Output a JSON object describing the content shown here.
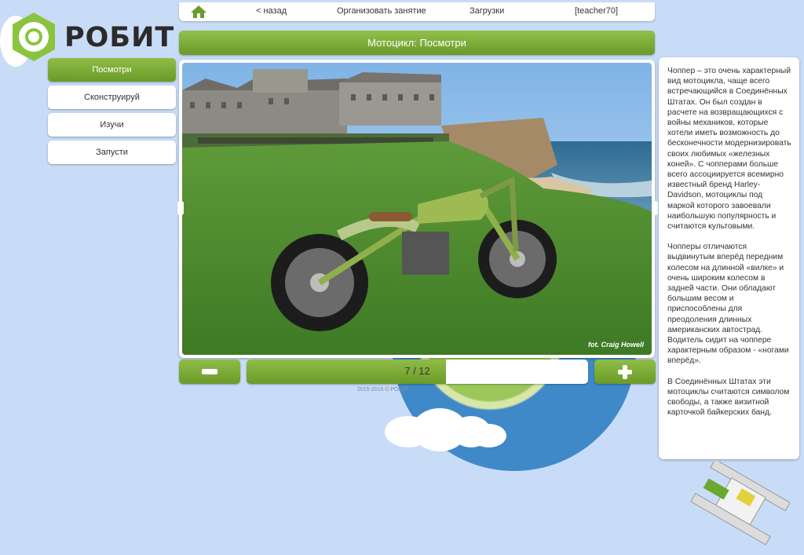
{
  "nav": {
    "back": "< назад",
    "organize": "Организовать занятие",
    "downloads": "Загрузки",
    "user": "[teacher70]"
  },
  "logo": {
    "text": "РОБИТ"
  },
  "menu": [
    {
      "label": "Посмотри",
      "active": true
    },
    {
      "label": "Сконструируй",
      "active": false
    },
    {
      "label": "Изучи",
      "active": false
    },
    {
      "label": "Запусти",
      "active": false
    }
  ],
  "title": "Мотоцикл: Посмотри",
  "photo": {
    "credit": "fot. Craig Howell"
  },
  "pager": {
    "current": 7,
    "total": 12,
    "label": "7 / 12"
  },
  "copyright": "2015-2016 © РОБИТ",
  "description": [
    "Чоппер – это очень характерный вид мотоцикла, чаще всего встречающийся в Соединённых Штатах. Он был создан в расчете на возвращающихся с войны механиков, которые хотели иметь возможность до бесконечности модернизировать своих любимых «железных коней». С чопперами больше всего ассоциируется всемирно известный бренд Harley-Davidson, мотоциклы под маркой которого завоевали наибольшую популярность и считаются культовыми.",
    "Чопперы отличаются выдвинутым вперёд передним колесом на длинной «вилке» и очень широким колесом в задней части. Они обладают большим весом и приспособлены для преодоления длинных американских автострад. Водитель сидит на чоппере характерным образом - «ногами вперёд».",
    "В Соединённых Штатах эти мотоциклы считаются символом свободы, а также визитной карточкой байкерских банд."
  ],
  "colors": {
    "accent_green": "#7aa935",
    "background": "#c9dcf7"
  }
}
